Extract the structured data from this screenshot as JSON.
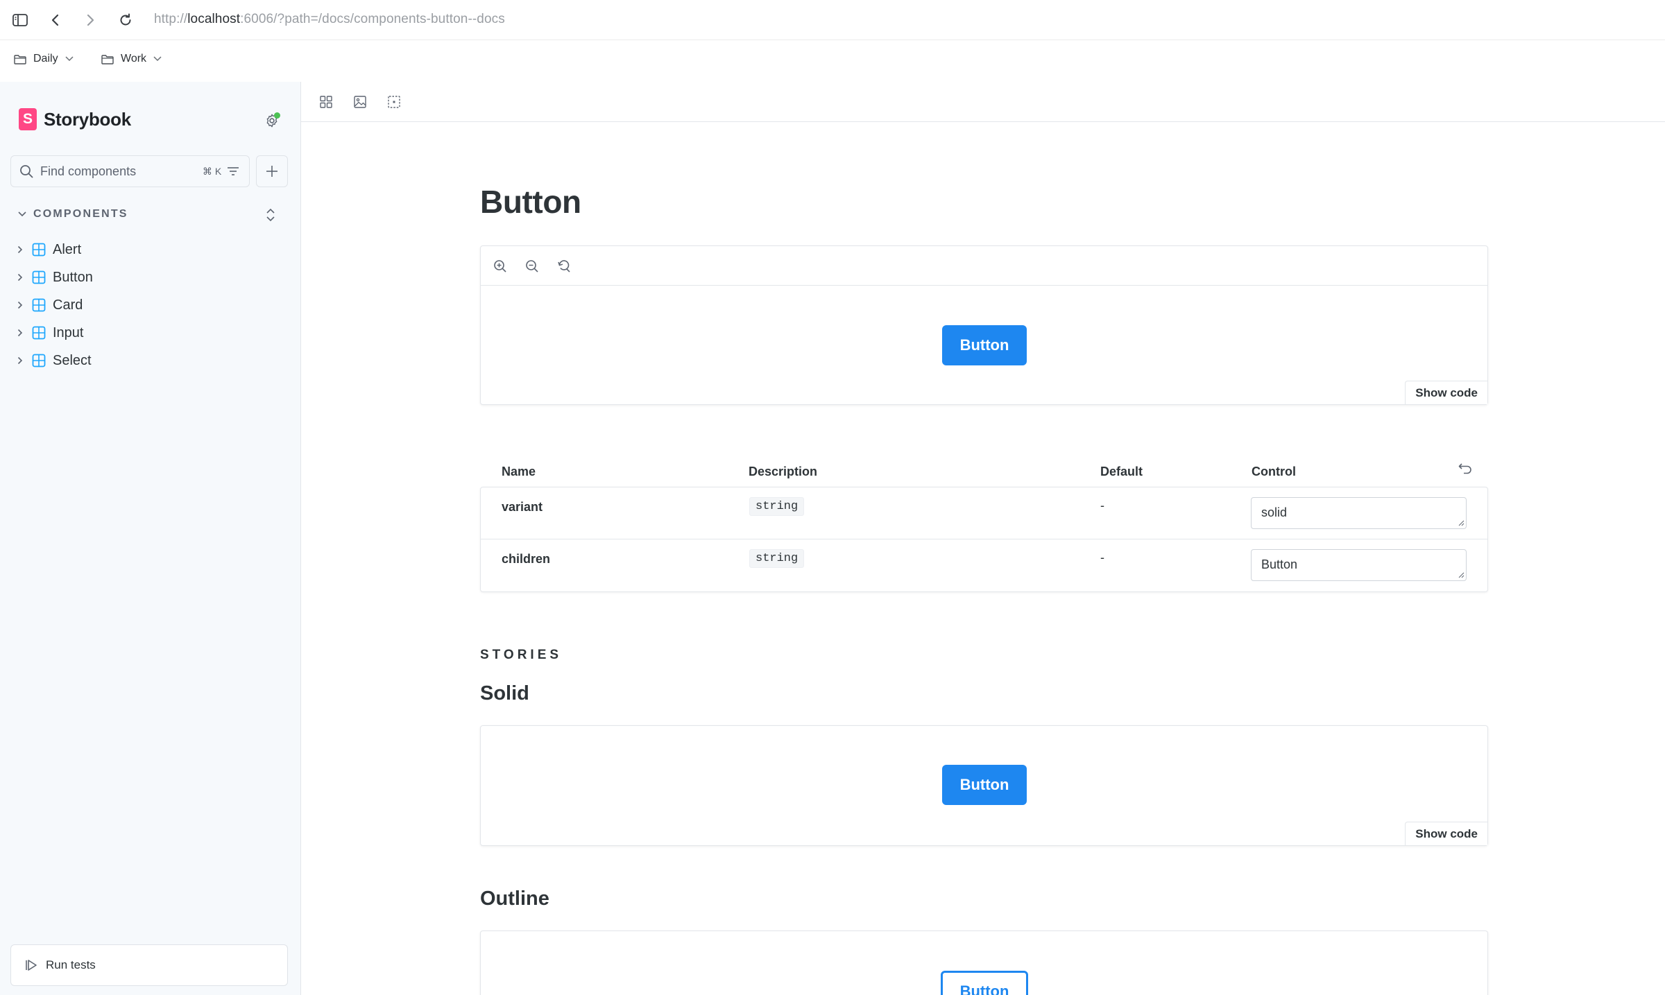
{
  "browser": {
    "url_scheme": "http://",
    "url_host": "localhost",
    "url_rest": ":6006/?path=/docs/components-button--docs"
  },
  "bookmarks": [
    {
      "label": "Daily"
    },
    {
      "label": "Work"
    }
  ],
  "sidebar": {
    "brand": "Storybook",
    "brand_mark": "S",
    "search_placeholder": "Find components",
    "search_shortcut": "⌘ K",
    "section_label": "COMPONENTS",
    "items": [
      {
        "label": "Alert"
      },
      {
        "label": "Button"
      },
      {
        "label": "Card"
      },
      {
        "label": "Input"
      },
      {
        "label": "Select"
      }
    ],
    "run_tests_label": "Run tests",
    "status_color": "#4cc154"
  },
  "doc": {
    "title": "Button",
    "primary_preview": {
      "button_label": "Button",
      "show_code_label": "Show code"
    },
    "args_table": {
      "headers": {
        "name": "Name",
        "description": "Description",
        "default": "Default",
        "control": "Control"
      },
      "rows": [
        {
          "name": "variant",
          "type": "string",
          "default": "-",
          "value": "solid"
        },
        {
          "name": "children",
          "type": "string",
          "default": "-",
          "value": "Button"
        }
      ]
    },
    "stories_label": "STORIES",
    "stories": [
      {
        "title": "Solid",
        "button_label": "Button",
        "show_code_label": "Show code"
      },
      {
        "title": "Outline",
        "button_label": "Button"
      }
    ]
  },
  "colors": {
    "accent": "#1e87f0",
    "brand": "#ff4785",
    "sidebar_bg": "#f6f9fc",
    "story_icon": "#1ea7fd"
  }
}
